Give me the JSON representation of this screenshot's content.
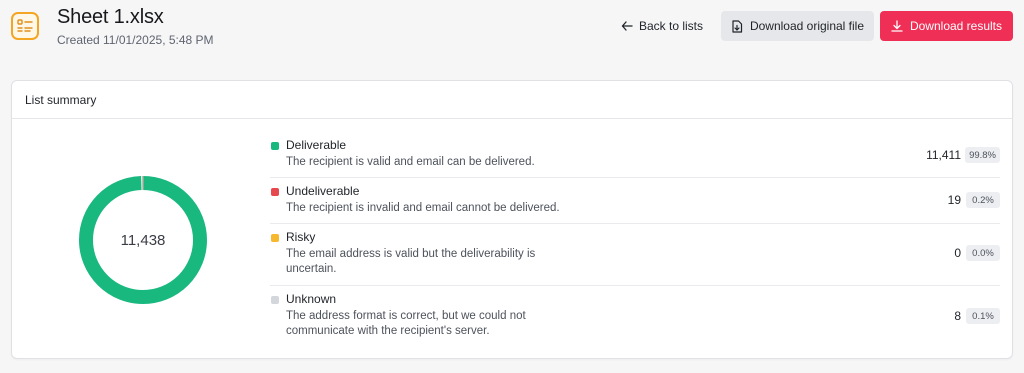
{
  "header": {
    "title": "Sheet 1.xlsx",
    "created": "Created 11/01/2025, 5:48 PM",
    "back_label": "Back to lists",
    "download_original_label": "Download original file",
    "download_results_label": "Download results"
  },
  "summary": {
    "title": "List summary",
    "total": "11,438",
    "statuses": [
      {
        "name": "Deliverable",
        "description": "The recipient is valid and email can be delivered.",
        "count": "11,411",
        "percent": "99.8%",
        "color": "#18b87f",
        "value": 11411
      },
      {
        "name": "Undeliverable",
        "description": "The recipient is invalid and email cannot be delivered.",
        "count": "19",
        "percent": "0.2%",
        "color": "#e5484d",
        "value": 19
      },
      {
        "name": "Risky",
        "description": "The email address is valid but the deliverability is uncertain.",
        "count": "0",
        "percent": "0.0%",
        "color": "#f5b82e",
        "value": 0
      },
      {
        "name": "Unknown",
        "description": "The address format is correct, but we could not communicate with the recipient's server.",
        "count": "8",
        "percent": "0.1%",
        "color": "#d3d6db",
        "value": 8
      }
    ]
  },
  "colors": {
    "accent": "#ef2f55",
    "file_icon": "#f4a623"
  }
}
